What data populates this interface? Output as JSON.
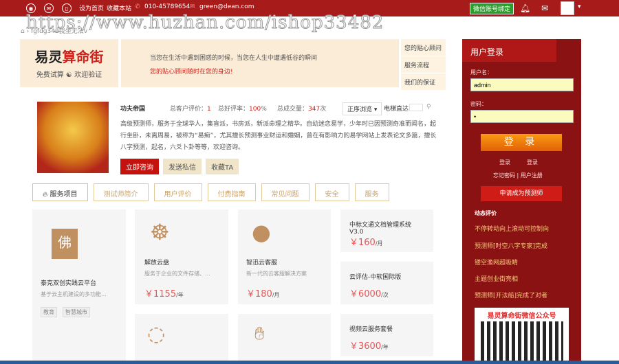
{
  "topbar": {
    "set_home": "设为首页",
    "bookmark": "收藏本站",
    "phone": "010-45789654",
    "email": "green@dean.com",
    "wechat_bind": "微信账号绑定"
  },
  "watermark": "https://www.huzhan.com/ishop33482",
  "breadcrumb": "fgfdg342我坐无法v",
  "logo": {
    "title_a": "易灵",
    "title_b": "算命街",
    "slogan": "免费试算 ☯ 欢迎验证"
  },
  "banner": {
    "line1": "当您在生活中遇到困惑的时候，当您在人生中遭遇低谷的瞬间",
    "line2": "您的贴心顾问随时在您的身边!"
  },
  "right_menu": [
    "您的贴心顾问",
    "服务流程",
    "我们的保证"
  ],
  "profile": {
    "name": "功夫帝国",
    "reviews_label": "总客户评价：",
    "reviews": "1",
    "rate_label": "总好评率：",
    "rate": "100",
    "rate_unit": "%",
    "deals_label": "总成交量：",
    "deals": "347",
    "deals_unit": "次",
    "sort": "正序浏览 ▾",
    "elevator": "电梯直达",
    "description": "高级预测师，服务于全球华人，集盲派，书房派，新派命理之精华。自幼迷恋易学，少年时已因预测奇准而闻名，起行坐卧，未离周易，被称为“易痴”，尤其擅长预测事业财运和婚姻，曾在有影响力的易学网站上发表论文多篇，擅长八字预测，起名，六爻卜卦等等，欢迎咨询。",
    "consult": "立即咨询",
    "message": "发送私信",
    "favorite": "收藏TA"
  },
  "tabs": [
    "服务项目",
    "测试师简介",
    "用户评价",
    "付费指南",
    "常见问题",
    "安全",
    "服务"
  ],
  "cards": [
    {
      "title": "泰克双创实践云平台",
      "desc": "基于云主机建设的多功能...",
      "tags": [
        "教育",
        "智慧城市"
      ]
    },
    {
      "title": "解放云盘",
      "desc": "服务于企业的文件存储、...",
      "price": "￥1155",
      "unit": "/年"
    },
    {
      "title": "智迅云客服",
      "desc": "新一代的云客服解决方案",
      "price": "￥180",
      "unit": "/月"
    },
    {
      "title": "中标文通文档管理系统V3.0",
      "price": "￥160",
      "unit": "/月"
    },
    {
      "title": "云评估-中软国际版",
      "price": "￥6000",
      "unit": "/次"
    },
    {
      "title": "视频云服务套餐",
      "price": "￥3600",
      "unit": "/年"
    }
  ],
  "login": {
    "title": "用户登录",
    "username_label": "用户名：",
    "username": "admin",
    "password_label": "密码：",
    "password": "•",
    "submit": "登 录",
    "link1": "登录",
    "link2": "登录",
    "forgot": "忘记密码 | 用户注册",
    "apply": "申请成为预测师"
  },
  "dynamic": {
    "title": "动态评价",
    "items": [
      "不停转动向上滚动可控制向",
      "预测师[时空八字专家]完成",
      "镂空渔网超吸睛",
      "主题创业街亮相",
      "预测师[开法船]完成了对者"
    ]
  },
  "qr_title": "易灵算命街微信公众号"
}
